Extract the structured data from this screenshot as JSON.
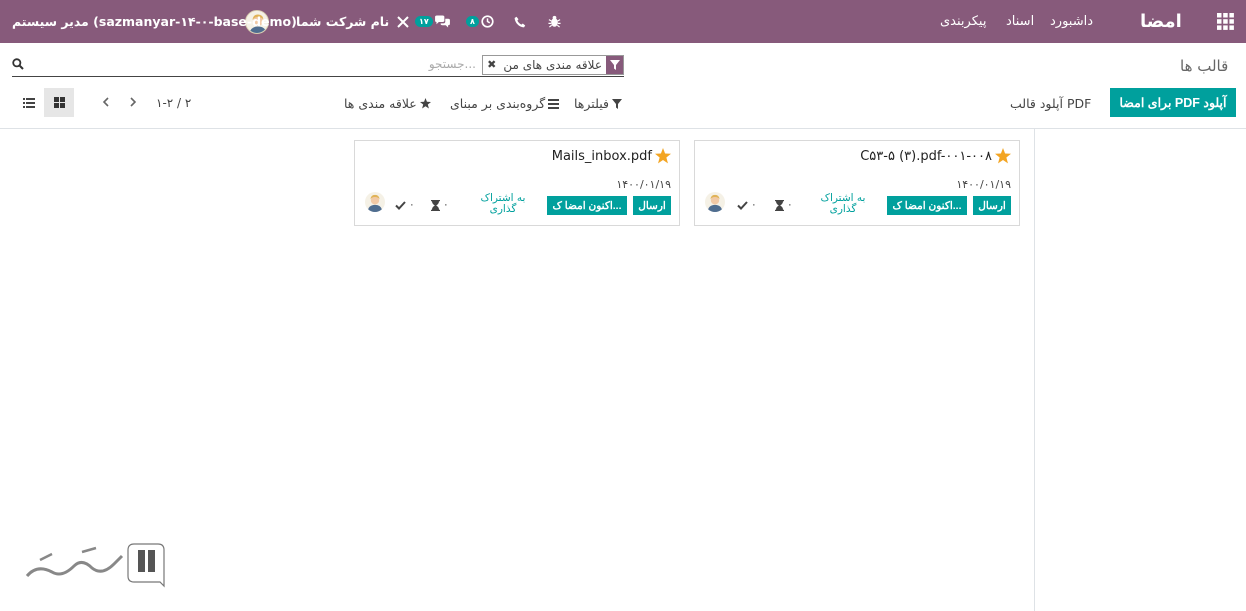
{
  "navbar": {
    "brand": "امضا",
    "menu": [
      "داشبورد",
      "اسناد",
      "پیکربندی"
    ],
    "activity_badge": "۸",
    "messages_badge": "۱۷",
    "company": "نام شرکت شما",
    "user": "مدیر سیستم (sazmanyar-۱۴-۰-base-demo)",
    "icons": [
      "apps-icon",
      "bug-icon",
      "phone-icon",
      "clock-icon",
      "chat-icon",
      "tools-icon",
      "user-avatar"
    ]
  },
  "control_panel": {
    "title": "قالب ها",
    "search": {
      "placeholder": "جستجو...",
      "facet": "علاقه مندی های من"
    },
    "buttons": {
      "upload_pdf_sign": "آپلود PDF برای امضا",
      "upload_template": "آپلود قالب PDF"
    },
    "dropdowns": {
      "filters": "فیلترها",
      "group_by": "گروه‌بندی بر مبنای",
      "favorites": "علاقه مندی ها"
    },
    "pager": "۱-۲ / ۲"
  },
  "cards": [
    {
      "name": "C۵۳-۵ (۳).pdf-۰۰۱-۰۰۸",
      "date": "۱۴۰۰/۰۱/۱۹",
      "send": "ارسال",
      "sign_now": "اکنون امضا ک...",
      "share": "به اشتراک گذاری",
      "count_check": "۰",
      "count_wait": "۰"
    },
    {
      "name": "Mails_inbox.pdf",
      "date": "۱۴۰۰/۰۱/۱۹",
      "send": "ارسال",
      "sign_now": "اکنون امضا ک...",
      "share": "به اشتراک گذاری",
      "count_check": "۰",
      "count_wait": "۰"
    }
  ],
  "colors": {
    "brand": "#875a7b",
    "primary": "#00a09d",
    "star": "#f3a523"
  }
}
